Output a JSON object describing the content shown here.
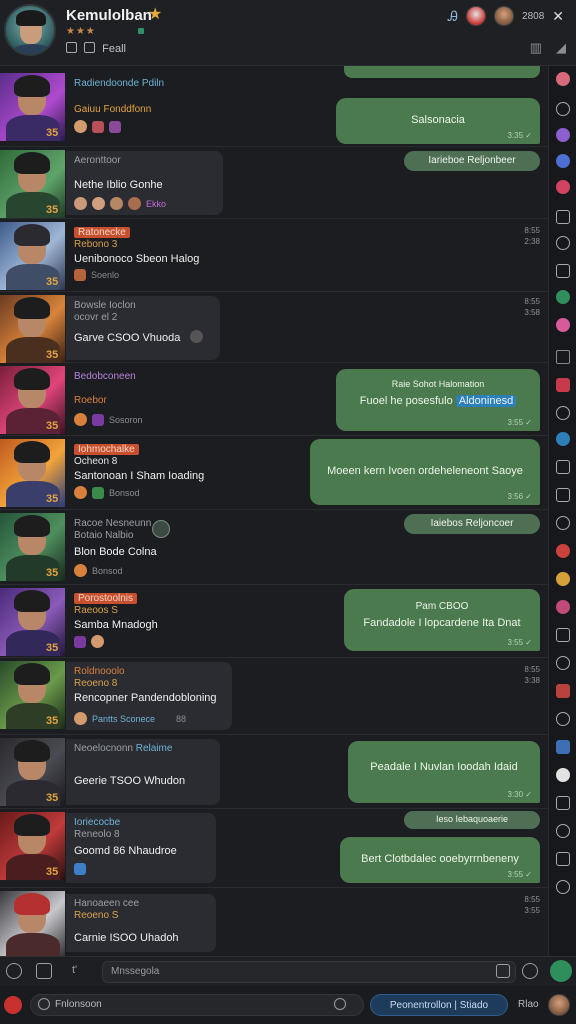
{
  "header": {
    "title": "Kemulolban",
    "rating_text": "★★★",
    "sub_label": "Feall",
    "time": "2808",
    "tools": [
      "▥",
      "◢"
    ]
  },
  "rows": [
    {
      "badge": "35",
      "top": "Radiendoonde Pdiln",
      "name": "Gaiuu Fonddfonn",
      "msg": "",
      "foot": "",
      "bubble": "Salsonacia",
      "bubble_meta": "3:35 ✓"
    },
    {
      "badge": "35",
      "top": "Aeronttoor",
      "name": "",
      "msg": "Nethe Iblio Gonhe",
      "foot": "Ekko",
      "bubble": "Iarieboe Reljonbeer",
      "bubble_meta": ""
    },
    {
      "badge": "35",
      "top": "Ratonecke",
      "name": "Rebono 3",
      "msg": "Uenibonoco Sbeon Halog",
      "foot": "Soenlo",
      "ts": "8:55\n2:38"
    },
    {
      "badge": "35",
      "top": "Bowsle Ioclon",
      "name": "ocovr el 2",
      "msg": "Garve CSOO Vhuoda",
      "foot": "",
      "ts": "8:55\n3:58"
    },
    {
      "badge": "35",
      "top": "Bedobconeen",
      "name": "Roebor",
      "msg": "",
      "foot": "Sosoron",
      "bubble_title": "Raie Sohot Halomation",
      "bubble": "Fuoel he posesfulo",
      "bubble_hl": "Aldoninesd",
      "bubble_meta": "3:55 ✓"
    },
    {
      "badge": "35",
      "top": "Iohmochalke",
      "name": "Ocheon 8",
      "msg": "Santonoan I Sham Ioading",
      "foot": "Bonsod",
      "bubble": "Moeen kern Ivoen ordeheleneont",
      "bubble_hl": "Saoye",
      "bubble_meta": "3:56 ✓"
    },
    {
      "badge": "35",
      "top": "Racoe Nesneunn",
      "name": "Botaio Nalbio",
      "msg": "Blon Bode Colna",
      "foot": "Bonsod",
      "bubble": "Iaiebos Reljoncoer",
      "bubble_meta": ""
    },
    {
      "badge": "35",
      "top": "Porostoolnis",
      "name": "Raeoos S",
      "msg": "Samba Mnadogh",
      "foot": "",
      "bubble_title": "Pam CBOO",
      "bubble": "Fandadole I lopcardene",
      "bubble_hl": "Ita Dnat",
      "bubble_meta": "3:55 ✓"
    },
    {
      "badge": "35",
      "top": "Roldnooolo",
      "name": "Reoeno 8",
      "msg": "Rencopner Pandendobloning",
      "foot": "Pantts Sconece",
      "foot2": "88",
      "ts": "8:55\n3:38"
    },
    {
      "badge": "35",
      "top": "Neoelocnonn",
      "top2": "Relaime",
      "name": "",
      "msg": "Geerie TSOO Whudon",
      "foot": "",
      "bubble": "Peadale I Nuvlan Ioodah",
      "bubble_hl": "Idaid",
      "bubble_meta": "3:30 ✓"
    },
    {
      "badge": "35",
      "top": "Ioriecocbe",
      "name": "Reneolo 8",
      "msg": "Goomd 86 Nhaudroe",
      "foot": "",
      "pill": "Ieso Iebaquoaerie",
      "bubble": "Bert Clotbdalec ooebyrrnbeneny",
      "bubble_meta": "3:55 ✓"
    },
    {
      "badge": "35",
      "top": "Hanoaeen cee",
      "name": "Reoeno S",
      "msg": "Carnie ISOO Uhadoh",
      "foot": "",
      "ts": "8:55\n3:55"
    }
  ],
  "composer": {
    "placeholder": "Mnssegola",
    "reply_placeholder": "Fnlonsoon",
    "send_label": "Peonentrollon | Stiado",
    "extra": "Rlao",
    "left_label": "t'"
  },
  "colors": {
    "accent_green": "#4a7a4e",
    "accent_blue": "#2d7fb8",
    "accent_orange": "#e3a340"
  }
}
